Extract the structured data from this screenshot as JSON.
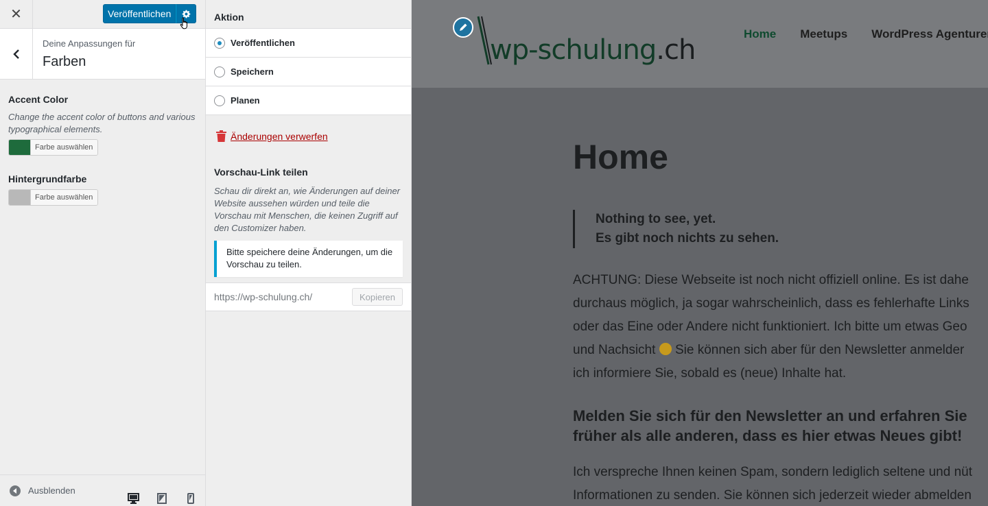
{
  "header": {
    "publish_label": "Veröffentlichen"
  },
  "section": {
    "subtitle": "Deine Anpassungen für",
    "title": "Farben"
  },
  "controls": [
    {
      "title": "Accent Color",
      "description": "Change the accent color of buttons and various typographical elements.",
      "button_label": "Farbe auswählen",
      "color": "#1e6b3c"
    },
    {
      "title": "Hintergrundfarbe",
      "button_label": "Farbe auswählen",
      "color": "#b8b8b8"
    }
  ],
  "footer": {
    "collapse_label": "Ausblenden"
  },
  "publish_settings": {
    "title": "Aktion",
    "options": [
      {
        "label": "Veröffentlichen",
        "selected": true
      },
      {
        "label": "Speichern",
        "selected": false
      },
      {
        "label": "Planen",
        "selected": false
      }
    ],
    "discard_label": "Änderungen verwerfen",
    "share": {
      "title": "Vorschau-Link teilen",
      "description": "Schau dir direkt an, wie Änderungen auf deiner Website aussehen würden und teile die Vorschau mit Menschen, die keinen Zugriff auf den Customizer haben.",
      "notice": "Bitte speichere deine Änderungen, um die Vorschau zu teilen.",
      "url": "https://wp-schulung.ch/",
      "copy_label": "Kopieren"
    }
  },
  "preview": {
    "logo_main": "wp-schulung",
    "logo_tld": ".ch",
    "nav": [
      "Home",
      "Meetups",
      "WordPress Agenturen"
    ],
    "page_title": "Home",
    "quote_lines": [
      "Nothing to see, yet.",
      "Es gibt noch nichts zu sehen."
    ],
    "paragraph_lines": [
      "ACHTUNG: Diese Webseite ist noch nicht offiziell online. Es ist dahe",
      "durchaus möglich, ja sogar wahrscheinlich, dass es fehlerhafte Links",
      "oder das Eine oder Andere nicht funktioniert. Ich bitte um etwas Geo",
      "und Nachsicht",
      "Sie können sich aber für den Newsletter anmelder",
      "ich informiere Sie, sobald es (neue) Inhalte hat."
    ],
    "heading_lines": [
      "Melden Sie sich für den Newsletter an und erfahren Sie",
      "früher als alle anderen, dass es hier etwas Neues gibt!"
    ],
    "paragraph2_lines": [
      "Ich verspreche Ihnen keinen Spam, sondern lediglich seltene und nüt",
      "Informationen zu senden. Sie können sich jederzeit wieder abmelden"
    ]
  },
  "colors": {
    "accent": "#0073aa",
    "discard": "#aa0000",
    "notice_border": "#00a0d2"
  }
}
